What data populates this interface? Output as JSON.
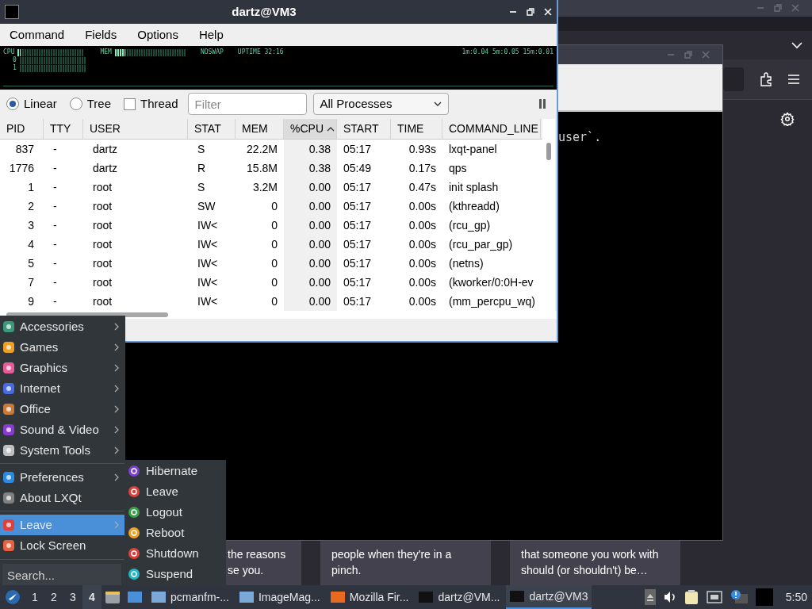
{
  "qps": {
    "title": "dartz@VM3",
    "menubar": [
      "Command",
      "Fields",
      "Options",
      "Help"
    ],
    "meter": {
      "cpu": {
        "label": "CPU",
        "level": 0.04
      },
      "mem": {
        "label": "MEM",
        "level": 0.15
      },
      "swap": "NOSWAP",
      "uptime": "UPTIME 32:16",
      "load": "1m:0.04 5m:0.05 15m:0.01",
      "cores": [
        "0",
        "1"
      ]
    },
    "view_modes": [
      {
        "label": "Linear",
        "selected": true
      },
      {
        "label": "Tree",
        "selected": false
      }
    ],
    "thread": {
      "label": "Thread",
      "checked": false
    },
    "filter": {
      "placeholder": "Filter"
    },
    "scope": "All Processes",
    "table": {
      "columns": [
        {
          "label": "PID",
          "sorted": false
        },
        {
          "label": "TTY",
          "sorted": false
        },
        {
          "label": "USER",
          "sorted": false
        },
        {
          "label": "STAT",
          "sorted": false
        },
        {
          "label": "MEM",
          "sorted": false
        },
        {
          "label": "%CPU",
          "sorted": true
        },
        {
          "label": "START",
          "sorted": false
        },
        {
          "label": "TIME",
          "sorted": false
        },
        {
          "label": "COMMAND_LINE",
          "sorted": false
        }
      ],
      "rows": [
        [
          "837",
          "-",
          "dartz",
          "S",
          "22.2M",
          "0.38",
          "05:17",
          "0.93s",
          "lxqt-panel"
        ],
        [
          "1776",
          "-",
          "dartz",
          "R",
          "15.8M",
          "0.38",
          "05:49",
          "0.17s",
          "qps"
        ],
        [
          "1",
          "-",
          "root",
          "S",
          "3.2M",
          "0.00",
          "05:17",
          "0.47s",
          "init splash"
        ],
        [
          "2",
          "-",
          "root",
          "SW",
          "0",
          "0.00",
          "05:17",
          "0.00s",
          "(kthreadd)"
        ],
        [
          "3",
          "-",
          "root",
          "IW<",
          "0",
          "0.00",
          "05:17",
          "0.00s",
          "(rcu_gp)"
        ],
        [
          "4",
          "-",
          "root",
          "IW<",
          "0",
          "0.00",
          "05:17",
          "0.00s",
          "(rcu_par_gp)"
        ],
        [
          "5",
          "-",
          "root",
          "IW<",
          "0",
          "0.00",
          "05:17",
          "0.00s",
          "(netns)"
        ],
        [
          "7",
          "-",
          "root",
          "IW<",
          "0",
          "0.00",
          "05:17",
          "0.00s",
          "(kworker/0:0H-ev"
        ],
        [
          "9",
          "-",
          "root",
          "IW<",
          "0",
          "0.00",
          "05:17",
          "0.00s",
          "(mm_percpu_wq)"
        ]
      ]
    }
  },
  "terminal": {
    "line": "user`."
  },
  "cards": [
    {
      "text": "the reasons se you."
    },
    {
      "text": "people when they're in a pinch."
    },
    {
      "text": "that someone you work with should (or shouldn't) be…"
    }
  ],
  "menu": {
    "sections": [
      [
        {
          "label": "Accessories",
          "submenu": true,
          "selected": false
        },
        {
          "label": "Games",
          "submenu": true,
          "selected": false
        },
        {
          "label": "Graphics",
          "submenu": true,
          "selected": false
        },
        {
          "label": "Internet",
          "submenu": true,
          "selected": false
        },
        {
          "label": "Office",
          "submenu": true,
          "selected": false
        },
        {
          "label": "Sound & Video",
          "submenu": true,
          "selected": false
        },
        {
          "label": "System Tools",
          "submenu": true,
          "selected": false
        }
      ],
      [
        {
          "label": "Preferences",
          "submenu": true,
          "selected": false
        },
        {
          "label": "About LXQt",
          "submenu": false,
          "selected": false
        }
      ],
      [
        {
          "label": "Leave",
          "submenu": true,
          "selected": true
        },
        {
          "label": "Lock Screen",
          "submenu": false,
          "selected": false
        }
      ]
    ],
    "search": {
      "placeholder": "Search..."
    },
    "leave_submenu": [
      {
        "label": "Hibernate",
        "color": "#7b3fd0"
      },
      {
        "label": "Leave",
        "color": "#e0403a"
      },
      {
        "label": "Logout",
        "color": "#3aa04a"
      },
      {
        "label": "Reboot",
        "color": "#f0a020"
      },
      {
        "label": "Shutdown",
        "color": "#e0403a"
      },
      {
        "label": "Suspend",
        "color": "#20b8c8"
      }
    ]
  },
  "taskbar": {
    "workspaces": [
      {
        "label": "1",
        "selected": false
      },
      {
        "label": "2",
        "selected": false
      },
      {
        "label": "3",
        "selected": false
      },
      {
        "label": "4",
        "selected": true
      }
    ],
    "tasks": [
      {
        "label": "pcmanfm-...",
        "active": false
      },
      {
        "label": "ImageMag...",
        "active": false
      },
      {
        "label": "Mozilla Fir...",
        "active": false
      },
      {
        "label": "dartz@VM...",
        "active": false
      },
      {
        "label": "dartz@VM3",
        "active": true
      }
    ],
    "clock": "5:50"
  }
}
